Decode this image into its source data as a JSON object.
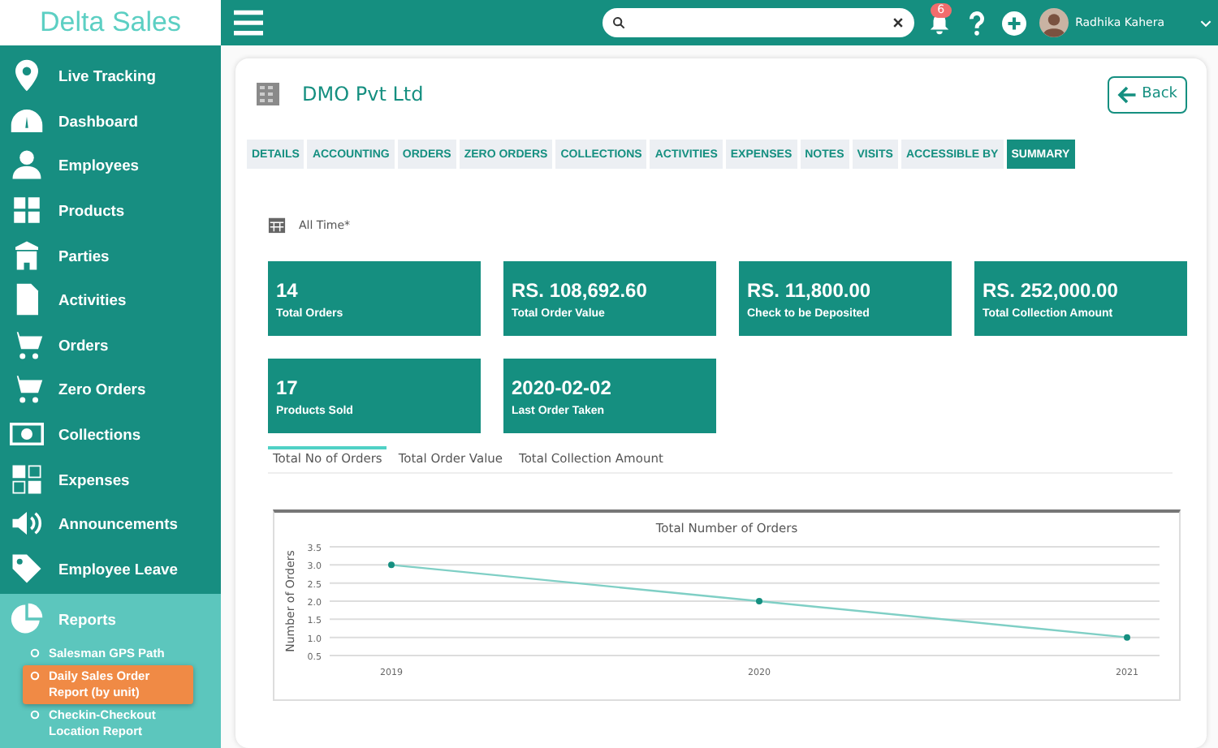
{
  "brand": "Delta Sales",
  "sidebar": {
    "items": [
      {
        "label": "Live Tracking"
      },
      {
        "label": "Dashboard"
      },
      {
        "label": "Employees"
      },
      {
        "label": "Products"
      },
      {
        "label": "Parties"
      },
      {
        "label": "Activities"
      },
      {
        "label": "Orders"
      },
      {
        "label": "Zero Orders"
      },
      {
        "label": "Collections"
      },
      {
        "label": "Expenses"
      },
      {
        "label": "Announcements"
      },
      {
        "label": "Employee Leave"
      }
    ],
    "reports": {
      "label": "Reports",
      "expanded": true,
      "children": [
        {
          "label": "Salesman GPS Path",
          "selected": false
        },
        {
          "label": "Daily Sales Order Report (by unit)",
          "selected": true
        },
        {
          "label": "Checkin-Checkout Location Report",
          "selected": false
        }
      ]
    }
  },
  "topbar": {
    "notification_count": "6",
    "user": "Radhika Kahera"
  },
  "party": {
    "name": "DMO Pvt Ltd",
    "back": "Back"
  },
  "tabs": [
    {
      "label": "DETAILS",
      "selected": false
    },
    {
      "label": "ACCOUNTING",
      "selected": false
    },
    {
      "label": "ORDERS",
      "selected": false
    },
    {
      "label": "ZERO ORDERS",
      "selected": false
    },
    {
      "label": "COLLECTIONS",
      "selected": false
    },
    {
      "label": "ACTIVITIES",
      "selected": false
    },
    {
      "label": "EXPENSES",
      "selected": false
    },
    {
      "label": "NOTES",
      "selected": false
    },
    {
      "label": "VISITS",
      "selected": false
    },
    {
      "label": "ACCESSIBLE BY",
      "selected": false
    },
    {
      "label": "SUMMARY",
      "selected": true
    }
  ],
  "period": "All Time*",
  "stats": [
    {
      "value": "14",
      "label": "Total Orders"
    },
    {
      "value": "RS. 108,692.60",
      "label": "Total Order Value"
    },
    {
      "value": "RS. 11,800.00",
      "label": "Check to be Deposited"
    },
    {
      "value": "RS. 252,000.00",
      "label": "Total Collection Amount"
    },
    {
      "value": "17",
      "label": "Products Sold"
    },
    {
      "value": "2020-02-02",
      "label": "Last Order Taken"
    }
  ],
  "chart_tabs": [
    {
      "label": "Total No of Orders",
      "selected": true
    },
    {
      "label": "Total Order Value",
      "selected": false
    },
    {
      "label": "Total Collection Amount",
      "selected": false
    }
  ],
  "chart": {
    "chart_data": {
      "type": "line",
      "title": "Total Number of Orders",
      "ylabel": "Number of Orders",
      "categories": [
        "2019",
        "2020",
        "2021"
      ],
      "grid": true,
      "series": [
        {
          "color": "#7fcfc5",
          "marker": "circle",
          "values": [
            3,
            2,
            1
          ]
        }
      ],
      "ylim": [
        0.5,
        3.5
      ],
      "yticks": [
        {
          "value": 0.5,
          "label": "0.5"
        },
        {
          "value": 1,
          "label": "1.0"
        },
        {
          "value": 1.5,
          "label": "1.5"
        },
        {
          "value": 2,
          "label": "2.0"
        },
        {
          "value": 2.5,
          "label": "2.5"
        },
        {
          "value": 3,
          "label": "3.0"
        },
        {
          "value": 3.5,
          "label": "3.5"
        }
      ]
    }
  }
}
